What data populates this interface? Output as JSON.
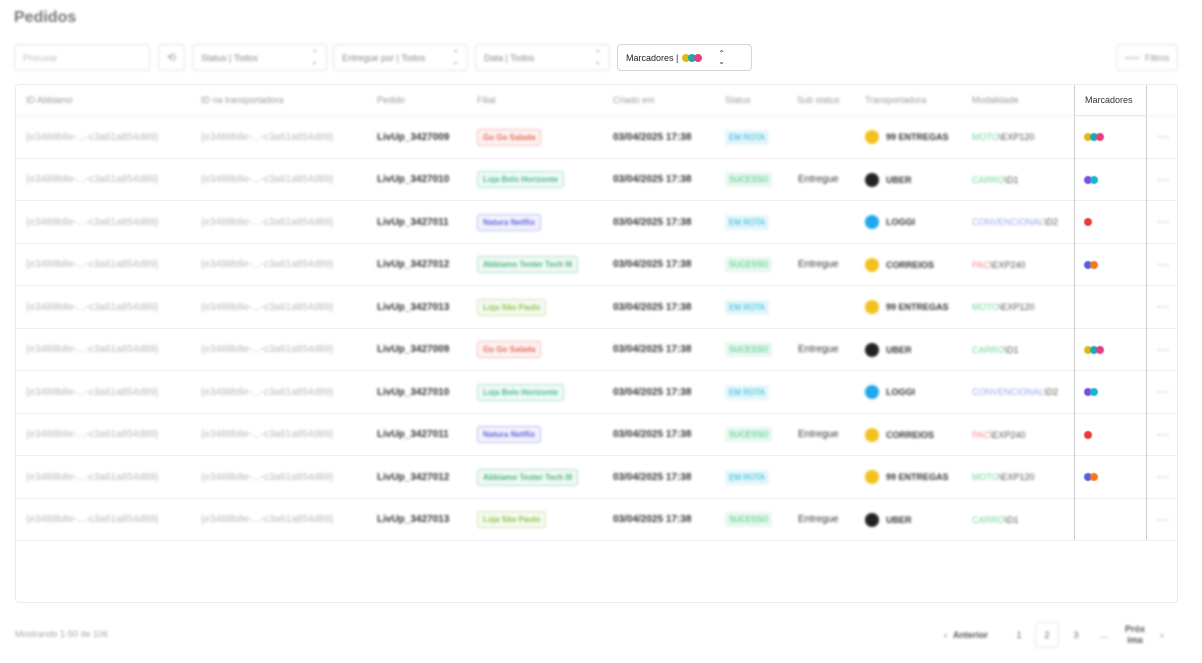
{
  "page": {
    "title": "Pedidos"
  },
  "filters": {
    "search_placeholder": "Procurar",
    "status": "Status | Todos",
    "entregue": "Entregue por | Todos",
    "data": "Data | Todos",
    "marcadores": "Marcadores |",
    "marcadores_dots": [
      "#e1b714",
      "#16a8b8",
      "#e53c7c"
    ],
    "filtros": "Filtros"
  },
  "table": {
    "columns": [
      "ID Abbiamo",
      "ID na transportadora",
      "Pedido",
      "Filial",
      "Criado em",
      "Status",
      "Sub status",
      "Transportadora",
      "Modalidade",
      "Marcadores"
    ],
    "rows": [
      {
        "id": "{e3488b8e-...-c3a61a854d89}",
        "id_t": "{e3488b8e-...-c3a61a854d89}",
        "pedido": "LivUp_3427009",
        "filial": "Go Go Salada",
        "filial_color": "#e46a5a",
        "criado": "03/04/2025 17:38",
        "status": "EM ROTA",
        "sub": "",
        "carrier": "99 ENTREGAS",
        "carrier_color": "#f2c21b",
        "mod_a": "MOTO",
        "mod_a_color": "#6fd39a",
        "mod_b": "\\EXP120",
        "marc": [
          "#e1b714",
          "#16a8b8",
          "#e53c7c"
        ]
      },
      {
        "id": "{e3488b8e-...-c3a61a854d89}",
        "id_t": "{e3488b8e-...-c3a61a854d89}",
        "pedido": "LivUp_3427010",
        "filial": "Loja Belo Horizonte",
        "filial_color": "#46b99a",
        "criado": "03/04/2025 17:38",
        "status": "SUCESSO",
        "sub": "Entregue",
        "carrier": "UBER",
        "carrier_color": "#222222",
        "mod_a": "CARRO",
        "mod_a_color": "#6fd39a",
        "mod_b": "\\D1",
        "marc": [
          "#7a4fe0",
          "#16b5c9"
        ]
      },
      {
        "id": "{e3488b8e-...-c3a61a854d89}",
        "id_t": "{e3488b8e-...-c3a61a854d89}",
        "pedido": "LivUp_3427011",
        "filial": "Natura Netflix",
        "filial_color": "#6466e0",
        "criado": "03/04/2025 17:38",
        "status": "EM ROTA",
        "sub": "",
        "carrier": "LOGGI",
        "carrier_color": "#1fa8ee",
        "mod_a": "CONVENCIONAL",
        "mod_a_color": "#9aa3e6",
        "mod_b": "\\D2",
        "marc": [
          "#e53a3a"
        ]
      },
      {
        "id": "{e3488b8e-...-c3a61a854d89}",
        "id_t": "{e3488b8e-...-c3a61a854d89}",
        "pedido": "LivUp_3427012",
        "filial": "Abbiamo Tester Tech III",
        "filial_color": "#4db57a",
        "criado": "03/04/2025 17:38",
        "status": "SUCESSO",
        "sub": "Entregue",
        "carrier": "CORREIOS",
        "carrier_color": "#f2c21b",
        "mod_a": "PAC",
        "mod_a_color": "#f08a8a",
        "mod_b": "\\EXP240",
        "marc": [
          "#5a5ee0",
          "#f07a1a"
        ]
      },
      {
        "id": "{e3488b8e-...-c3a61a854d89}",
        "id_t": "{e3488b8e-...-c3a61a854d89}",
        "pedido": "LivUp_3427013",
        "filial": "Loja São Paulo",
        "filial_color": "#8dc34a",
        "criado": "03/04/2025 17:38",
        "status": "EM ROTA",
        "sub": "",
        "carrier": "99 ENTREGAS",
        "carrier_color": "#f2c21b",
        "mod_a": "MOTO",
        "mod_a_color": "#6fd39a",
        "mod_b": "\\EXP120",
        "marc": []
      },
      {
        "id": "{e3488b8e-...-c3a61a854d89}",
        "id_t": "{e3488b8e-...-c3a61a854d89}",
        "pedido": "LivUp_3427009",
        "filial": "Go Go Salada",
        "filial_color": "#e46a5a",
        "criado": "03/04/2025 17:38",
        "status": "SUCESSO",
        "sub": "Entregue",
        "carrier": "UBER",
        "carrier_color": "#222222",
        "mod_a": "CARRO",
        "mod_a_color": "#6fd39a",
        "mod_b": "\\D1",
        "marc": [
          "#e1b714",
          "#16a8b8",
          "#e53c7c"
        ]
      },
      {
        "id": "{e3488b8e-...-c3a61a854d89}",
        "id_t": "{e3488b8e-...-c3a61a854d89}",
        "pedido": "LivUp_3427010",
        "filial": "Loja Belo Horizonte",
        "filial_color": "#46b99a",
        "criado": "03/04/2025 17:38",
        "status": "EM ROTA",
        "sub": "",
        "carrier": "LOGGI",
        "carrier_color": "#1fa8ee",
        "mod_a": "CONVENCIONAL",
        "mod_a_color": "#9aa3e6",
        "mod_b": "\\D2",
        "marc": [
          "#7a4fe0",
          "#16b5c9"
        ]
      },
      {
        "id": "{e3488b8e-...-c3a61a854d89}",
        "id_t": "{e3488b8e-...-c3a61a854d89}",
        "pedido": "LivUp_3427011",
        "filial": "Natura Netflix",
        "filial_color": "#6466e0",
        "criado": "03/04/2025 17:38",
        "status": "SUCESSO",
        "sub": "Entregue",
        "carrier": "CORREIOS",
        "carrier_color": "#f2c21b",
        "mod_a": "PAC",
        "mod_a_color": "#f08a8a",
        "mod_b": "\\EXP240",
        "marc": [
          "#e53a3a"
        ]
      },
      {
        "id": "{e3488b8e-...-c3a61a854d89}",
        "id_t": "{e3488b8e-...-c3a61a854d89}",
        "pedido": "LivUp_3427012",
        "filial": "Abbiamo Tester Tech III",
        "filial_color": "#4db57a",
        "criado": "03/04/2025 17:38",
        "status": "EM ROTA",
        "sub": "",
        "carrier": "99 ENTREGAS",
        "carrier_color": "#f2c21b",
        "mod_a": "MOTO",
        "mod_a_color": "#6fd39a",
        "mod_b": "\\EXP120",
        "marc": [
          "#5a5ee0",
          "#f07a1a"
        ]
      },
      {
        "id": "{e3488b8e-...-c3a61a854d89}",
        "id_t": "{e3488b8e-...-c3a61a854d89}",
        "pedido": "LivUp_3427013",
        "filial": "Loja São Paulo",
        "filial_color": "#8dc34a",
        "criado": "03/04/2025 17:38",
        "status": "SUCESSO",
        "sub": "Entregue",
        "carrier": "UBER",
        "carrier_color": "#222222",
        "mod_a": "CARRO",
        "mod_a_color": "#6fd39a",
        "mod_b": "\\D1",
        "marc": []
      }
    ]
  },
  "status_colors": {
    "EM ROTA": "#1fb3d6",
    "SUCESSO": "#3cc57a"
  },
  "footer": {
    "showing": "Mostrando 1-50 de 106",
    "prev": "Anterior",
    "pages": [
      "1",
      "2",
      "3",
      "..."
    ],
    "active_page": "2",
    "next": "Próx ima"
  }
}
